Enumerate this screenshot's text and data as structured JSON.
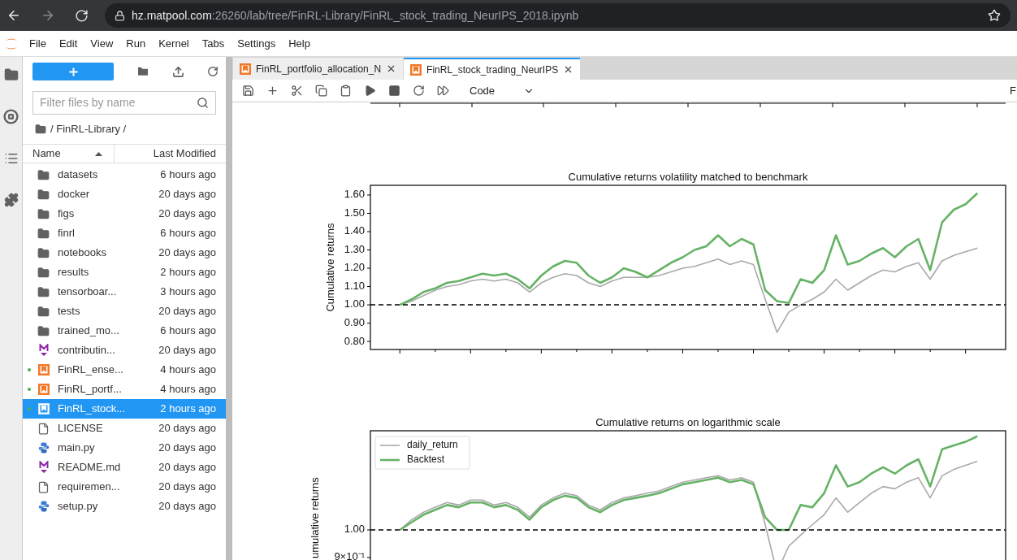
{
  "browser": {
    "url_host": "hz.matpool.com",
    "url_path": ":26260/lab/tree/FinRL-Library/FinRL_stock_trading_NeurIPS_2018.ipynb"
  },
  "menu": [
    "File",
    "Edit",
    "View",
    "Run",
    "Kernel",
    "Tabs",
    "Settings",
    "Help"
  ],
  "file_browser": {
    "filter": {
      "placeholder": "Filter files by name"
    },
    "breadcrumb": "/ FinRL-Library /",
    "columns": [
      {
        "label": "Name",
        "sorted": true
      },
      {
        "label": "Last Modified",
        "sorted": false
      }
    ],
    "files": [
      {
        "name": "datasets",
        "modified": "6 hours ago",
        "kind": "folder",
        "running": false,
        "selected": false
      },
      {
        "name": "docker",
        "modified": "20 days ago",
        "kind": "folder",
        "running": false,
        "selected": false
      },
      {
        "name": "figs",
        "modified": "20 days ago",
        "kind": "folder",
        "running": false,
        "selected": false
      },
      {
        "name": "finrl",
        "modified": "6 hours ago",
        "kind": "folder",
        "running": false,
        "selected": false
      },
      {
        "name": "notebooks",
        "modified": "20 days ago",
        "kind": "folder",
        "running": false,
        "selected": false
      },
      {
        "name": "results",
        "modified": "2 hours ago",
        "kind": "folder",
        "running": false,
        "selected": false
      },
      {
        "name": "tensorboar...",
        "modified": "3 hours ago",
        "kind": "folder",
        "running": false,
        "selected": false
      },
      {
        "name": "tests",
        "modified": "20 days ago",
        "kind": "folder",
        "running": false,
        "selected": false
      },
      {
        "name": "trained_mo...",
        "modified": "6 hours ago",
        "kind": "folder",
        "running": false,
        "selected": false
      },
      {
        "name": "contributin...",
        "modified": "20 days ago",
        "kind": "markdown",
        "running": false,
        "selected": false
      },
      {
        "name": "FinRL_ense...",
        "modified": "4 hours ago",
        "kind": "notebook",
        "running": true,
        "selected": false
      },
      {
        "name": "FinRL_portf...",
        "modified": "4 hours ago",
        "kind": "notebook",
        "running": true,
        "selected": false
      },
      {
        "name": "FinRL_stock...",
        "modified": "2 hours ago",
        "kind": "notebook",
        "running": true,
        "selected": true
      },
      {
        "name": "LICENSE",
        "modified": "20 days ago",
        "kind": "file",
        "running": false,
        "selected": false
      },
      {
        "name": "main.py",
        "modified": "20 days ago",
        "kind": "python",
        "running": false,
        "selected": false
      },
      {
        "name": "README.md",
        "modified": "20 days ago",
        "kind": "markdown",
        "running": false,
        "selected": false
      },
      {
        "name": "requiremen...",
        "modified": "20 days ago",
        "kind": "file",
        "running": false,
        "selected": false
      },
      {
        "name": "setup.py",
        "modified": "20 days ago",
        "kind": "python",
        "running": false,
        "selected": false
      }
    ]
  },
  "tabs": [
    {
      "label": "FinRL_portfolio_allocation_N",
      "selected": false
    },
    {
      "label": "FinRL_stock_trading_NeurIPS",
      "selected": true
    }
  ],
  "toolbar": {
    "cell_type": "Code",
    "kernel": "F"
  },
  "charts": [
    {
      "chart_data": {
        "type": "line",
        "title": "Cumulative returns volatility matched to benchmark",
        "ylabel": "Cumulative returns",
        "ylim": [
          0.756,
          1.653
        ],
        "yticks": [
          {
            "value": 0.8,
            "label": "0.80"
          },
          {
            "value": 0.9,
            "label": "0.90"
          },
          {
            "value": 1.0,
            "label": "1.00"
          },
          {
            "value": 1.1,
            "label": "1.10"
          },
          {
            "value": 1.2,
            "label": "1.20"
          },
          {
            "value": 1.3,
            "label": "1.30"
          },
          {
            "value": 1.4,
            "label": "1.40"
          },
          {
            "value": 1.5,
            "label": "1.50"
          },
          {
            "value": 1.6,
            "label": "1.60"
          }
        ],
        "series": [
          {
            "color": "#a9a9a9",
            "values": [
              1.0,
              1.02,
              1.05,
              1.08,
              1.1,
              1.11,
              1.13,
              1.14,
              1.13,
              1.14,
              1.12,
              1.07,
              1.12,
              1.15,
              1.17,
              1.16,
              1.12,
              1.1,
              1.13,
              1.15,
              1.15,
              1.15,
              1.16,
              1.18,
              1.2,
              1.21,
              1.23,
              1.25,
              1.22,
              1.24,
              1.22,
              1.03,
              0.85,
              0.96,
              1.0,
              1.03,
              1.07,
              1.14,
              1.08,
              1.12,
              1.16,
              1.19,
              1.18,
              1.21,
              1.23,
              1.14,
              1.24,
              1.27,
              1.29,
              1.31
            ]
          },
          {
            "color": "#66b266",
            "values": [
              1.0,
              1.03,
              1.07,
              1.09,
              1.12,
              1.13,
              1.15,
              1.17,
              1.16,
              1.17,
              1.14,
              1.09,
              1.16,
              1.21,
              1.24,
              1.23,
              1.16,
              1.12,
              1.15,
              1.2,
              1.18,
              1.15,
              1.19,
              1.23,
              1.26,
              1.3,
              1.32,
              1.38,
              1.32,
              1.36,
              1.33,
              1.08,
              1.02,
              1.01,
              1.14,
              1.12,
              1.19,
              1.38,
              1.22,
              1.24,
              1.28,
              1.31,
              1.26,
              1.32,
              1.36,
              1.19,
              1.45,
              1.52,
              1.55,
              1.61
            ]
          }
        ]
      }
    },
    {
      "chart_data": {
        "type": "line",
        "title": "Cumulative returns on logarithmic scale",
        "ylabel": "umulative returns",
        "ylim": [
          0.844,
          1.359
        ],
        "yticks": [
          {
            "value": 0.9,
            "label": "9×10⁻¹"
          },
          {
            "value": 1.0,
            "label": "1.00"
          }
        ],
        "legend": true,
        "series": [
          {
            "name": "daily_return",
            "color": "#a9a9a9",
            "values": [
              1.0,
              1.037,
              1.064,
              1.082,
              1.099,
              1.09,
              1.108,
              1.108,
              1.09,
              1.099,
              1.082,
              1.046,
              1.09,
              1.116,
              1.133,
              1.124,
              1.09,
              1.073,
              1.099,
              1.116,
              1.124,
              1.133,
              1.141,
              1.157,
              1.173,
              1.181,
              1.189,
              1.196,
              1.181,
              1.189,
              1.173,
              1.019,
              0.846,
              0.941,
              0.981,
              1.019,
              1.055,
              1.116,
              1.064,
              1.099,
              1.133,
              1.157,
              1.149,
              1.173,
              1.189,
              1.116,
              1.196,
              1.219,
              1.234,
              1.249
            ]
          },
          {
            "name": "Backtest",
            "color": "#66b266",
            "values": [
              1.0,
              1.028,
              1.055,
              1.073,
              1.09,
              1.082,
              1.099,
              1.099,
              1.082,
              1.09,
              1.073,
              1.037,
              1.082,
              1.108,
              1.124,
              1.116,
              1.082,
              1.064,
              1.09,
              1.108,
              1.116,
              1.124,
              1.133,
              1.149,
              1.165,
              1.173,
              1.181,
              1.189,
              1.173,
              1.181,
              1.165,
              1.046,
              1.0,
              1.0,
              1.09,
              1.082,
              1.133,
              1.234,
              1.157,
              1.173,
              1.204,
              1.227,
              1.204,
              1.234,
              1.256,
              1.157,
              1.292,
              1.306,
              1.319,
              1.339
            ]
          }
        ]
      }
    }
  ]
}
